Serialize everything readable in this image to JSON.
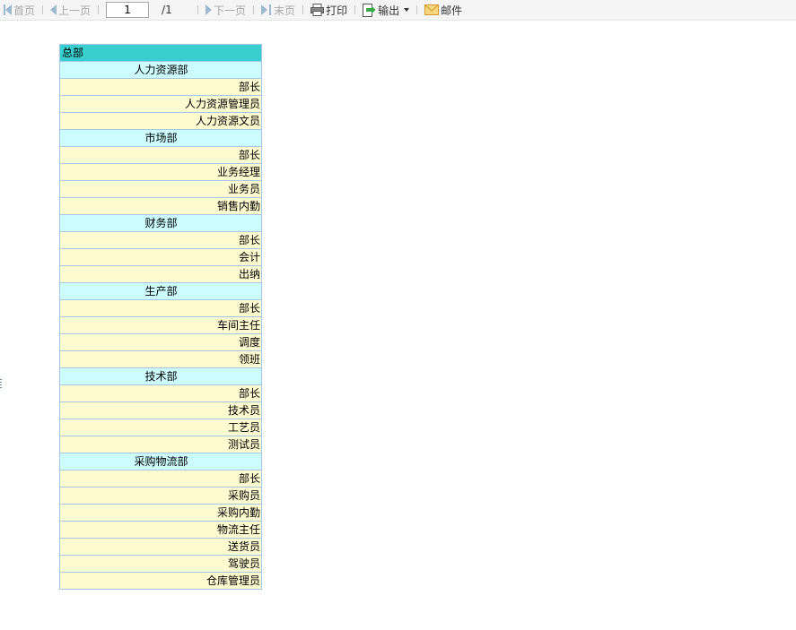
{
  "toolbar": {
    "first": "首页",
    "prev": "上一页",
    "page_value": "1",
    "page_total": "/1",
    "next": "下一页",
    "last": "末页",
    "print": "打印",
    "export": "输出",
    "mail": "邮件"
  },
  "report": {
    "root": "总部",
    "departments": [
      {
        "name": "人力资源部",
        "positions": [
          "部长",
          "人力资源管理员",
          "人力资源文员"
        ]
      },
      {
        "name": "市场部",
        "positions": [
          "部长",
          "业务经理",
          "业务员",
          "销售内勤"
        ]
      },
      {
        "name": "财务部",
        "positions": [
          "部长",
          "会计",
          "出纳"
        ]
      },
      {
        "name": "生产部",
        "positions": [
          "部长",
          "车间主任",
          "调度",
          "领班"
        ]
      },
      {
        "name": "技术部",
        "positions": [
          "部长",
          "技术员",
          "工艺员",
          "测试员"
        ]
      },
      {
        "name": "采购物流部",
        "positions": [
          "部长",
          "采购员",
          "采购内勤",
          "物流主任",
          "送货员",
          "驾驶员",
          "仓库管理员"
        ]
      }
    ]
  },
  "colors": {
    "root_bg": "#39cfcf",
    "dept_bg": "#ccfcfe",
    "position_bg": "#fffbd0",
    "grid_border": "#a6c6e6"
  }
}
